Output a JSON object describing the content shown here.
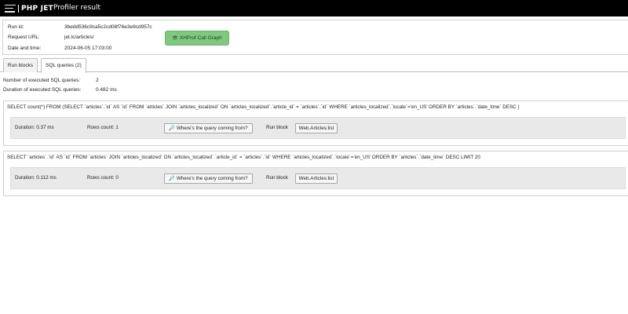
{
  "header": {
    "logo_text": "PHP JET",
    "title": "Profiler result"
  },
  "info": {
    "run_id_label": "Run id:",
    "run_id": "3bedd536c9ca5c2cd08f76e3e9cd957c",
    "request_url_label": "Request URL:",
    "request_url": "jet.lc/articles/",
    "date_label": "Date and time:",
    "date": "2024-06-05 17:03:00",
    "xhprof_button": "XHProf Call Graph"
  },
  "tabs": [
    {
      "label": "Run blocks",
      "active": false
    },
    {
      "label": "SQL queries (2)",
      "active": true
    }
  ],
  "summary": {
    "count_label": "Number of executed SQL queries:",
    "count": "2",
    "duration_label": "Duration of executed SQL queries:",
    "duration": "0.482 ms"
  },
  "queries": [
    {
      "sql": "SELECT count(*) FROM (SELECT `articles`.`id` AS `id` FROM `articles` JOIN `articles_localized` ON `articles_localized`.`article_id` = `articles`.`id` WHERE `articles_localized`.`locale`='en_US' ORDER BY `articles`.`date_time` DESC )",
      "duration": "Duration: 0.37 ms",
      "rows": "Rows count: 1",
      "where_button": "Where's the query coming from?",
      "run_block_label": "Run block",
      "run_block": "Web.Articles:list"
    },
    {
      "sql": "SELECT `articles`.`id` AS `id` FROM `articles` JOIN `articles_localized` ON `articles_localized`.`article_id` = `articles`.`id` WHERE `articles_localized`.`locale`='en_US' ORDER BY `articles`.`date_time` DESC LIMIT 20",
      "duration": "Duration: 0.112 ms",
      "rows": "Rows count: 0",
      "where_button": "Where's the query coming from?",
      "run_block_label": "Run block",
      "run_block": "Web.Articles:list"
    }
  ],
  "icons": {
    "logo": "logo-lines-icon",
    "xhprof": "eye-icon",
    "where": "search-icon"
  },
  "colors": {
    "topbar": "#000000",
    "xhprof_button": "#7fc97f",
    "query_inner": "#e9e9e9"
  }
}
